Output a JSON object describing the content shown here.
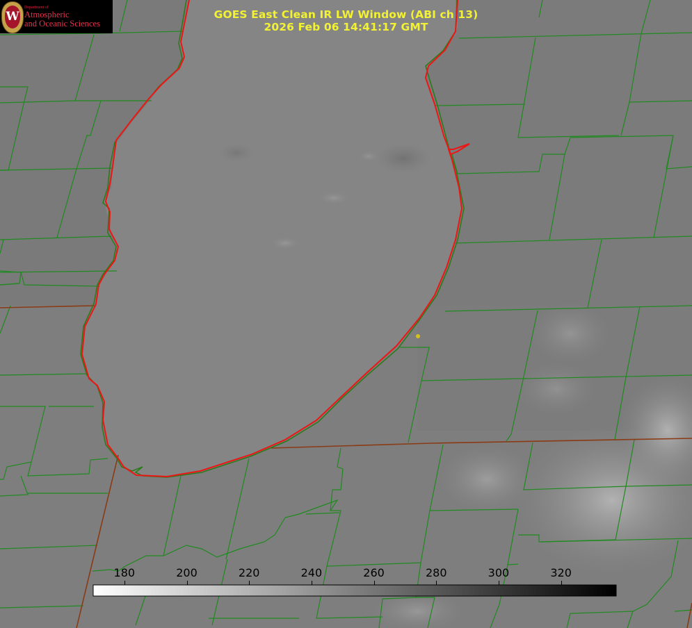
{
  "header": {
    "title_line1": "GOES East Clean IR LW Window (ABI ch 13)",
    "title_line2": "2026 Feb 06 14:41:17 GMT"
  },
  "logo": {
    "department": "Department of",
    "line1": "Atmospheric",
    "line2": "and Oceanic Sciences",
    "seal_letter": "W"
  },
  "colorbar": {
    "ticks": [
      "180",
      "200",
      "220",
      "240",
      "260",
      "280",
      "300",
      "320"
    ],
    "tick_values": [
      180,
      200,
      220,
      240,
      260,
      280,
      300,
      320
    ],
    "gradient_from": "#ffffff",
    "gradient_to": "#000000"
  },
  "colors": {
    "background_gray": "#808080",
    "county_lines": "#1f8a1f",
    "state_lines": "#8a3a14",
    "lake_outline": "#ff1a1a",
    "title_text": "#f2f233",
    "marker": "#d4c21a"
  },
  "map": {
    "marker_icon": "location-dot-icon"
  }
}
